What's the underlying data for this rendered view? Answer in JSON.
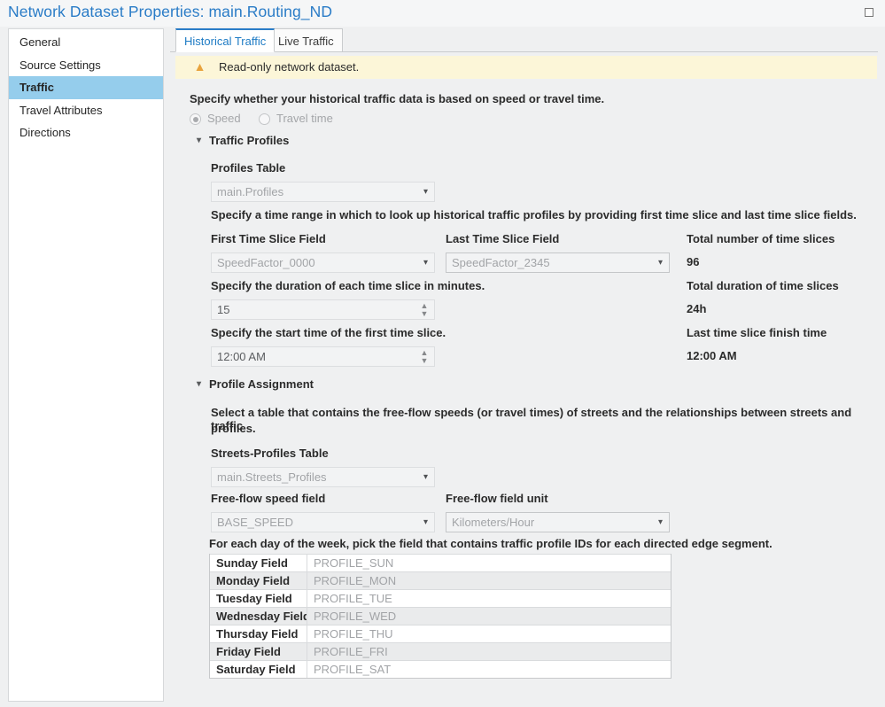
{
  "window": {
    "title": "Network Dataset Properties: main.Routing_ND",
    "restore_icon": "restore-window-icon",
    "accent_color": "#2a7cc7"
  },
  "sidebar": {
    "items": [
      {
        "label": "General",
        "selected": false
      },
      {
        "label": "Source Settings",
        "selected": false
      },
      {
        "label": "Traffic",
        "selected": true
      },
      {
        "label": "Travel Attributes",
        "selected": false
      },
      {
        "label": "Directions",
        "selected": false
      }
    ],
    "selected_highlight_color": "#95cdec"
  },
  "tabs": [
    {
      "label": "Historical Traffic",
      "active": true
    },
    {
      "label": "Live Traffic",
      "active": false
    }
  ],
  "warning": {
    "icon": "warning-triangle-icon",
    "text": "Read-only network dataset.",
    "background_color": "#fcf6d8",
    "icon_color": "#e8a33d"
  },
  "data_basis": {
    "description": "Specify whether your historical traffic data is based on speed or travel time.",
    "options": [
      {
        "label": "Speed",
        "checked": true
      },
      {
        "label": "Travel time",
        "checked": false
      }
    ]
  },
  "traffic_profiles": {
    "section_title": "Traffic Profiles",
    "collapse_icon": "chevron-down-icon",
    "profiles_table_label": "Profiles Table",
    "profiles_table_value": "main.Profiles",
    "time_range_description": "Specify a time range in which to look up historical traffic profiles by providing first time slice and last time slice fields.",
    "first_time_slice_label": "First Time Slice Field",
    "first_time_slice_value": "SpeedFactor_0000",
    "last_time_slice_label": "Last Time Slice Field",
    "last_time_slice_value": "SpeedFactor_2345",
    "duration_description": "Specify the duration of each time slice in minutes.",
    "duration_value": "15",
    "start_time_description": "Specify the start time of the first time slice.",
    "start_time_value": "12:00 AM",
    "totals": [
      {
        "label": "Total number of time slices",
        "value": "96"
      },
      {
        "label": "Total duration of time slices",
        "value": "24h"
      },
      {
        "label": "Last time slice finish time",
        "value": "12:00 AM"
      }
    ]
  },
  "profile_assignment": {
    "section_title": "Profile Assignment",
    "collapse_icon": "chevron-down-icon",
    "description_line1": "Select a table that contains the free-flow speeds (or travel times) of streets and the relationships between streets and traffic",
    "description_line2": "profiles.",
    "streets_profiles_label": "Streets-Profiles Table",
    "streets_profiles_value": "main.Streets_Profiles",
    "free_flow_speed_field_label": "Free-flow speed field",
    "free_flow_speed_field_value": "BASE_SPEED",
    "free_flow_unit_label": "Free-flow field unit",
    "free_flow_unit_value": "Kilometers/Hour",
    "days_description": "For each day of the week, pick the field that contains traffic profile IDs for each directed edge segment.",
    "day_fields": [
      {
        "label": "Sunday Field",
        "value": "PROFILE_SUN"
      },
      {
        "label": "Monday Field",
        "value": "PROFILE_MON"
      },
      {
        "label": "Tuesday Field",
        "value": "PROFILE_TUE"
      },
      {
        "label": "Wednesday Field",
        "value": "PROFILE_WED"
      },
      {
        "label": "Thursday Field",
        "value": "PROFILE_THU"
      },
      {
        "label": "Friday Field",
        "value": "PROFILE_FRI"
      },
      {
        "label": "Saturday Field",
        "value": "PROFILE_SAT"
      }
    ]
  },
  "icons": {
    "dropdown_arrow": "chevron-down-icon",
    "spinner_up": "chevron-up-icon",
    "spinner_down": "chevron-down-icon"
  }
}
